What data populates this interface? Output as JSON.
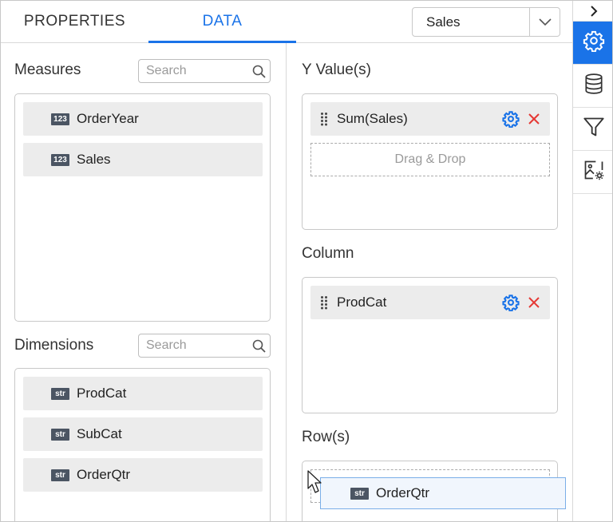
{
  "tabs": {
    "properties": "PROPERTIES",
    "data": "DATA"
  },
  "datasource": {
    "selected": "Sales"
  },
  "rail": {
    "icons": [
      "chevron-right-icon",
      "gear-icon",
      "database-icon",
      "filter-icon",
      "image-settings-icon"
    ],
    "active": "gear-icon"
  },
  "measures": {
    "title": "Measures",
    "search_placeholder": "Search",
    "items": [
      {
        "type": "123",
        "label": "OrderYear"
      },
      {
        "type": "123",
        "label": "Sales"
      }
    ]
  },
  "dimensions": {
    "title": "Dimensions",
    "search_placeholder": "Search",
    "items": [
      {
        "type": "str",
        "label": "ProdCat"
      },
      {
        "type": "str",
        "label": "SubCat"
      },
      {
        "type": "str",
        "label": "OrderQtr"
      }
    ]
  },
  "y_values": {
    "title": "Y Value(s)",
    "items": [
      {
        "label": "Sum(Sales)"
      }
    ],
    "drop_hint": "Drag & Drop"
  },
  "column": {
    "title": "Column",
    "items": [
      {
        "label": "ProdCat"
      }
    ]
  },
  "rows": {
    "title": "Row(s)",
    "items": []
  },
  "drag_ghost": {
    "type": "str",
    "label": "OrderQtr"
  },
  "colors": {
    "accent": "#1a73e8",
    "remove": "#e53935",
    "badge": "#4b5563"
  }
}
